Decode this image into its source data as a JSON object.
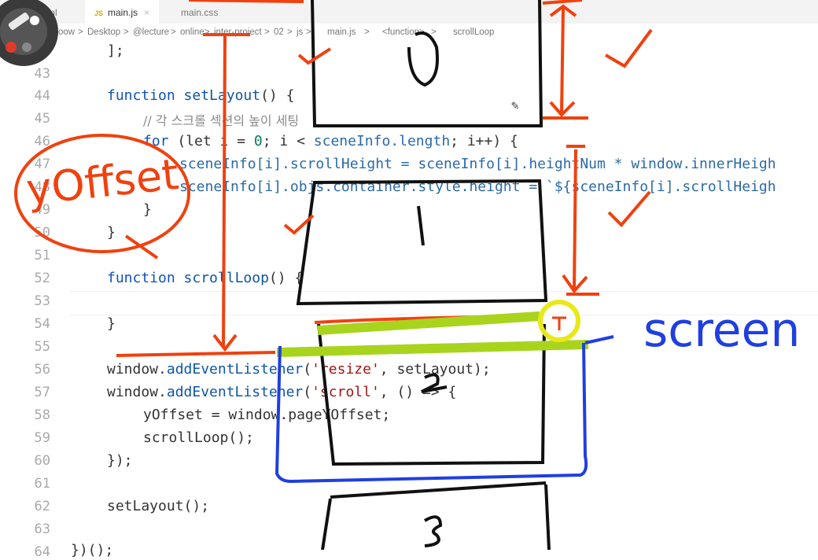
{
  "tabs": [
    {
      "label": "ml",
      "active": false
    },
    {
      "label": "main.js",
      "active": true,
      "badge": "JS"
    },
    {
      "label": "main.css",
      "active": false
    }
  ],
  "breadcrumb": [
    "oow",
    "Desktop",
    "@lecture",
    "online",
    "inter-project",
    "02",
    "js",
    "main.js",
    "<function>",
    "scrollLoop"
  ],
  "line_numbers": [
    "43",
    "44",
    "45",
    "46",
    "47",
    "48",
    "49",
    "50",
    "51",
    "52",
    "53",
    "54",
    "55",
    "56",
    "57",
    "58",
    "59",
    "60",
    "61",
    "62",
    "63",
    "64"
  ],
  "code": {
    "l42": "];",
    "l44_kw": "function",
    "l44_name": "setLayout",
    "l44_rest": "() {",
    "l45": "// 각 스크롤 섹션의 높이 세팅",
    "l46_kw": "for",
    "l46_a": " (let i = ",
    "l46_num": "0",
    "l46_b": "; i < ",
    "l46_prop": "sceneInfo.length",
    "l46_c": "; i++) {",
    "l47_a": "sceneInfo[i].scrollHeight = sceneInfo[i].heightNum * window.innerHeigh",
    "l48_a": "sceneInfo[i].objs.container.style.height = `${sceneInfo[i].scrollHeigh",
    "l49": "}",
    "l50": "}",
    "l52_kw": "function",
    "l52_name": "scrollLoop",
    "l52_rest": "() {",
    "l54": "}",
    "l56_a": "window.",
    "l56_fn": "addEventListener",
    "l56_b": "(",
    "l56_str": "'resize'",
    "l56_c": ", setLayout);",
    "l57_a": "window.",
    "l57_fn": "addEventListener",
    "l57_b": "(",
    "l57_str": "'scroll'",
    "l57_c": ", () => {",
    "l58": "yOffset = window.pageYOffset;",
    "l59": "scrollLoop();",
    "l60": "});",
    "l62": "setLayout();",
    "l64": "})();"
  },
  "annotations": {
    "left_label": "yOffset",
    "right_label": "screen",
    "section_labels": [
      "0",
      "1",
      "2",
      "3"
    ]
  },
  "colors": {
    "annotation_red": "#f0410f",
    "annotation_blue": "#1f3fe0",
    "annotation_green": "#a8d41e",
    "annotation_yellow": "#e8e81a"
  }
}
